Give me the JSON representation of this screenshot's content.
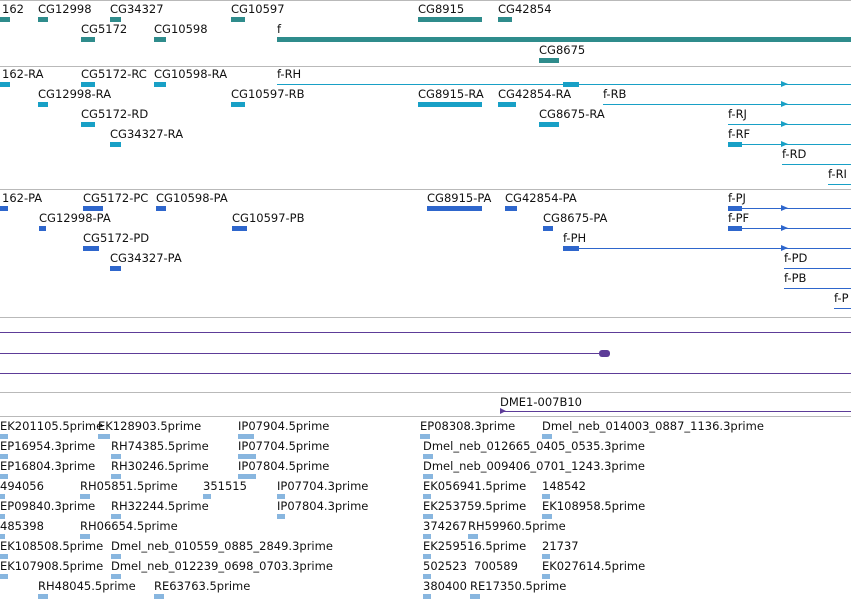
{
  "colors": {
    "gene": "#2f8c8c",
    "transcript": "#18a0c6",
    "protein": "#2e66cc",
    "other": "#5d3c98",
    "est": "#88b6df",
    "separator": "#b9b9b9"
  },
  "gene_track": {
    "labels": [
      "162",
      "CG12998",
      "CG34327",
      "CG10597",
      "CG8915",
      "CG42854",
      "CG5172",
      "CG10598",
      "f",
      "CG8675"
    ]
  },
  "transcript_track": {
    "labels": [
      "162-RA",
      "CG5172-RC",
      "CG10598-RA",
      "f-RH",
      "CG12998-RA",
      "CG10597-RB",
      "CG8915-RA",
      "CG42854-RA",
      "f-RB",
      "CG5172-RD",
      "CG8675-RA",
      "f-RJ",
      "CG34327-RA",
      "f-RF",
      "f-RD",
      "f-RI"
    ]
  },
  "protein_track": {
    "labels": [
      "162-PA",
      "CG5172-PC",
      "CG10598-PA",
      "CG8915-PA",
      "CG42854-PA",
      "f-PJ",
      "CG12998-PA",
      "CG10597-PB",
      "CG8675-PA",
      "f-PF",
      "CG5172-PD",
      "f-PH",
      "CG34327-PA",
      "f-PD",
      "f-PB",
      "f-P"
    ]
  },
  "clone_track": {
    "labels": [
      "DME1-007B10"
    ]
  },
  "est_track": {
    "labels": [
      "EK201105.5prime",
      "EK128903.5prime",
      "IP07904.5prime",
      "EP08308.3prime",
      "Dmel_neb_014003_0887_1136.3prime",
      "EP16954.3prime",
      "RH74385.5prime",
      "IP07704.5prime",
      "Dmel_neb_012665_0405_0535.3prime",
      "EP16804.3prime",
      "RH30246.5prime",
      "IP07804.5prime",
      "Dmel_neb_009406_0701_1243.3prime",
      "494056",
      "RH05851.5prime",
      "351515",
      "IP07704.3prime",
      "EK056941.5prime",
      "148542",
      "EP09840.3prime",
      "RH32244.5prime",
      "IP07804.3prime",
      "EK253759.5prime",
      "EK108958.5prime",
      "485398",
      "RH06654.5prime",
      "374267",
      "RH59960.5prime",
      "EK108508.5prime",
      "Dmel_neb_010559_0885_2849.3prime",
      "EK259516.5prime",
      "21737",
      "EK107908.5prime",
      "Dmel_neb_012239_0698_0703.3prime",
      "502523",
      "700589",
      "EK027614.5prime",
      "RH48045.5prime",
      "RE63763.5prime",
      "380400",
      "RE17350.5prime"
    ]
  }
}
